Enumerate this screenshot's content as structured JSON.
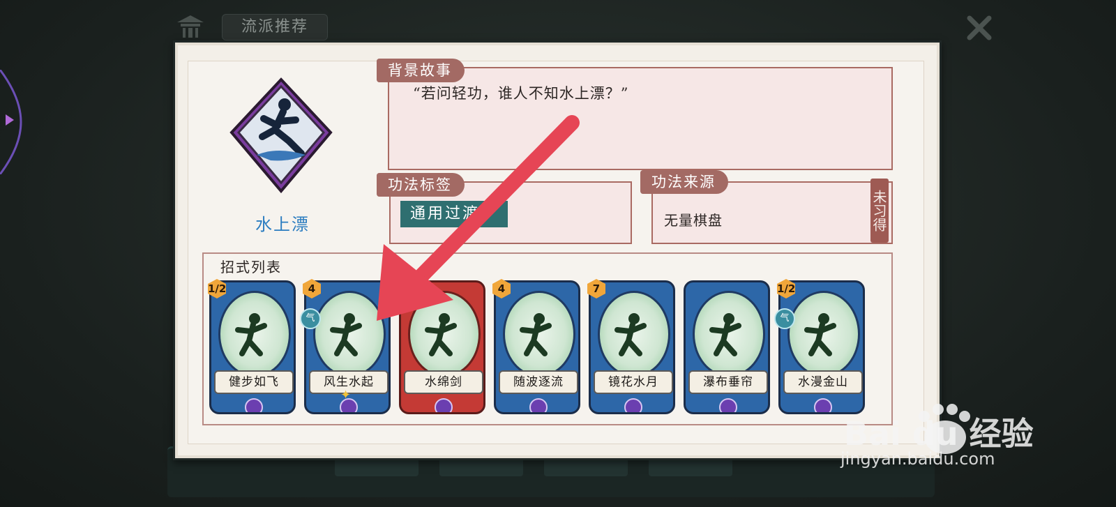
{
  "header": {
    "tab_label": "流派推荐"
  },
  "skill": {
    "name": "水上漂"
  },
  "story": {
    "label": "背景故事",
    "text": "“若问轻功，谁人不知水上漂？”"
  },
  "tags": {
    "label": "功法标签",
    "value": "通用过渡"
  },
  "source": {
    "label": "功法来源",
    "value": "无量棋盘",
    "status": "未习得"
  },
  "moves": {
    "label": "招式列表",
    "cards": [
      {
        "name": "健步如飞",
        "cost": "1/2",
        "qi": false,
        "color": "blue"
      },
      {
        "name": "风生水起",
        "cost": "4",
        "qi": true,
        "color": "blue",
        "upgraded": true
      },
      {
        "name": "水绵剑",
        "cost": "",
        "qi": false,
        "color": "red"
      },
      {
        "name": "随波逐流",
        "cost": "4",
        "qi": false,
        "color": "blue"
      },
      {
        "name": "镜花水月",
        "cost": "7",
        "qi": false,
        "color": "blue"
      },
      {
        "name": "瀑布垂帘",
        "cost": "",
        "qi": false,
        "color": "blue"
      },
      {
        "name": "水漫金山",
        "cost": "1/2",
        "qi": true,
        "color": "blue"
      }
    ]
  },
  "watermark": {
    "brand": "Bai du 经验",
    "url": "jingyan.baidu.com"
  },
  "colors": {
    "accent": "#2a7cc0",
    "label_bg": "#a36a64",
    "arrow": "#e64555"
  }
}
